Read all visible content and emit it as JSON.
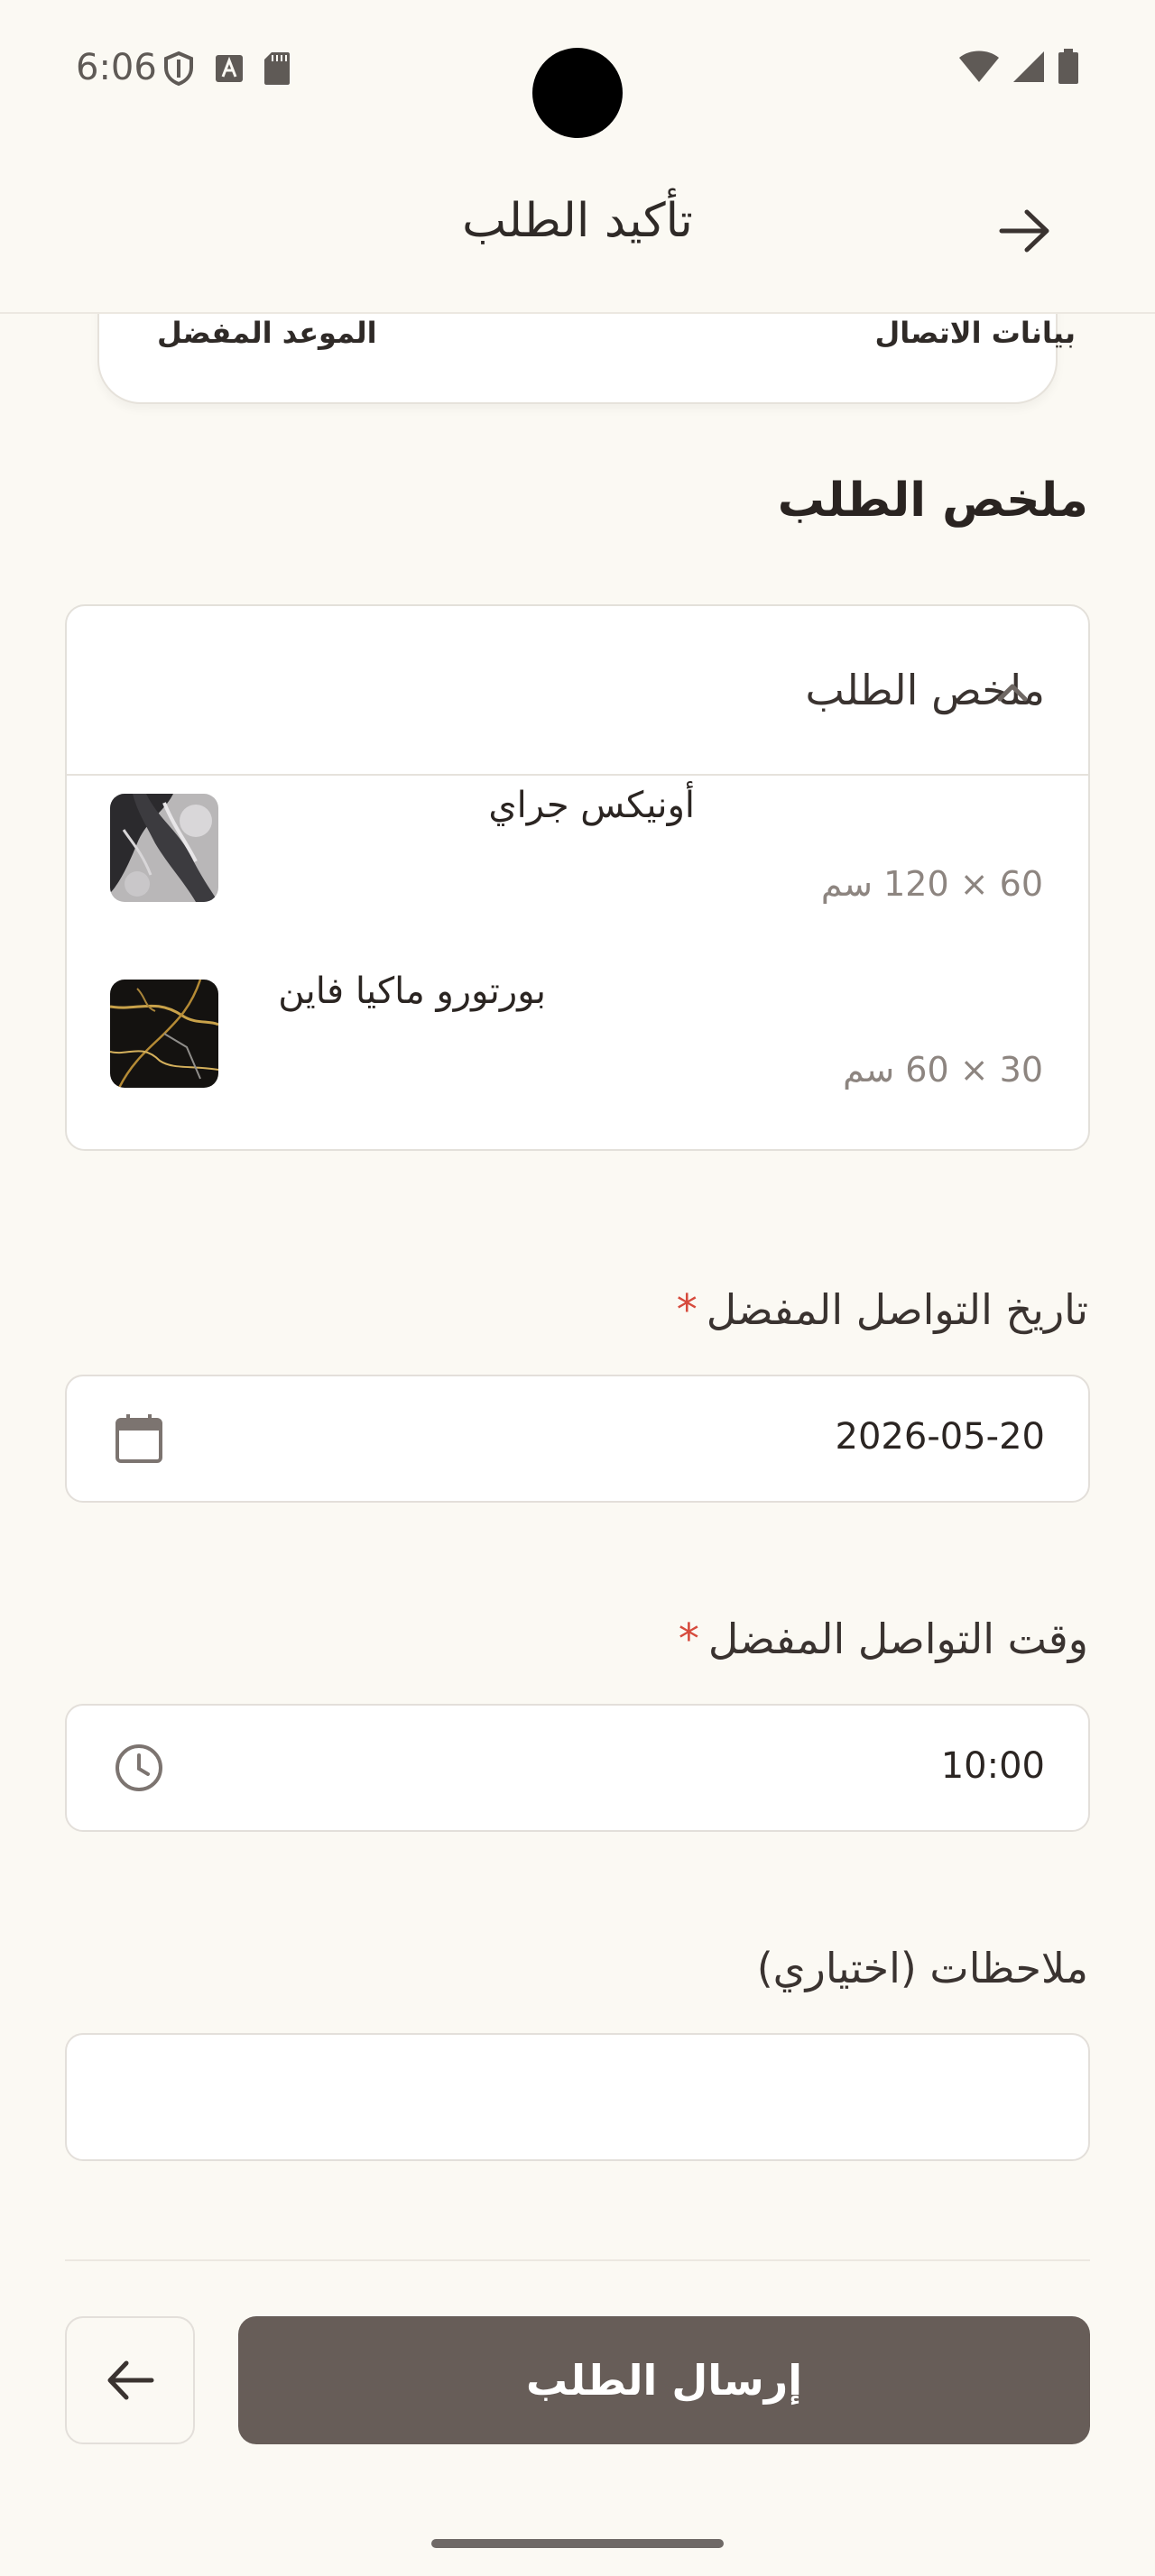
{
  "status_bar": {
    "time": "6:06",
    "left_icons": [
      "shield-icon",
      "font-icon",
      "sd-card-icon"
    ],
    "right_icons": [
      "wifi-icon",
      "signal-icon",
      "battery-icon"
    ]
  },
  "header": {
    "title": "تأكيد الطلب",
    "back_icon": "arrow-right-icon"
  },
  "steps_card": {
    "contact_label": "بيانات الاتصال",
    "date_label": "الموعد المفضل"
  },
  "summary_section": {
    "title": "ملخص الطلب",
    "panel_label": "ملخص الطلب",
    "items": [
      {
        "name": "أونيكس جراي",
        "size": "60 × 120 سم"
      },
      {
        "name": "بورتورو ماكيا فاين",
        "size": "30 × 60 سم"
      }
    ]
  },
  "form": {
    "date": {
      "label": "تاريخ التواصل المفضل",
      "required_mark": "*",
      "value": "2026-05-20"
    },
    "time": {
      "label": "وقت التواصل المفضل",
      "required_mark": "*",
      "value": "10:00"
    },
    "notes": {
      "label": "ملاحظات (اختياري)",
      "value": ""
    }
  },
  "actions": {
    "submit_label": "إرسال الطلب",
    "prev_icon": "arrow-left-icon"
  },
  "colors": {
    "background": "#fbf9f3",
    "primary_button": "#675d58",
    "required": "#d64a3c"
  }
}
